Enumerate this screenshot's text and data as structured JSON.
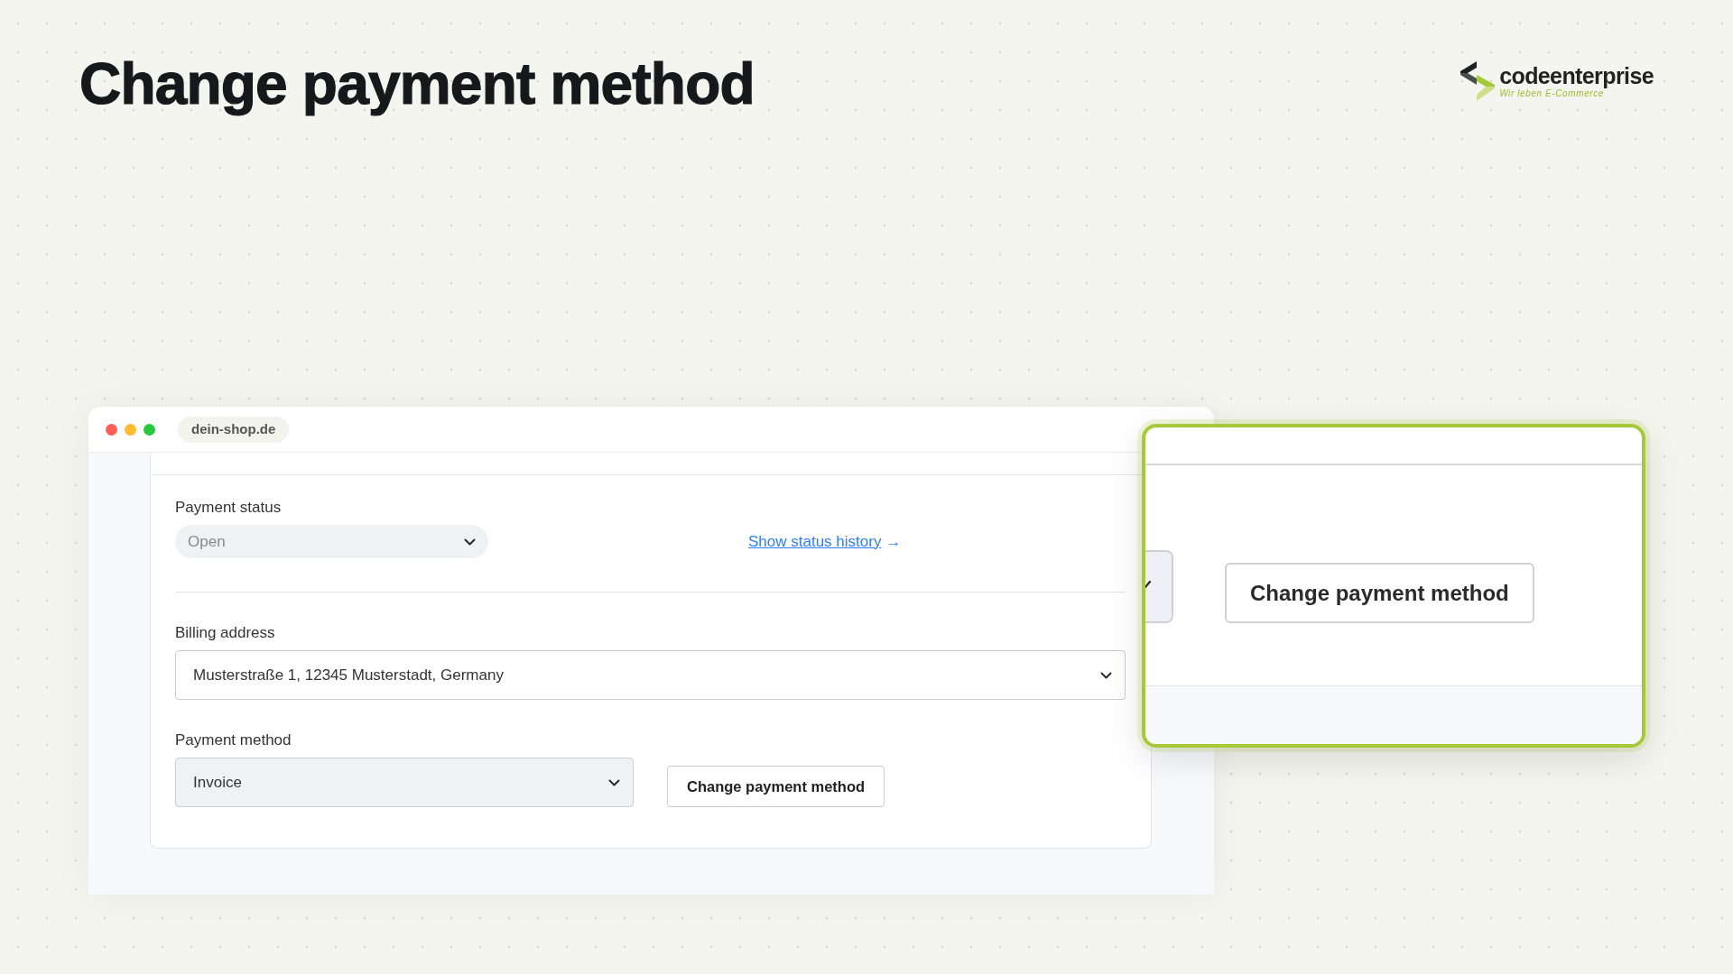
{
  "header": {
    "title": "Change payment method"
  },
  "logo": {
    "wordmark": "codeenterprise",
    "tagline": "Wir leben E-Commerce"
  },
  "browser": {
    "url": "dein-shop.de"
  },
  "form": {
    "payment_status": {
      "label": "Payment status",
      "select": {
        "value": "Open",
        "kind": "pill",
        "disabled": true
      }
    },
    "status_link": {
      "label": "Show status history",
      "arrow": "→"
    },
    "billing_address": {
      "label": "Billing address",
      "select": {
        "value": "Musterstraße 1, 12345 Musterstadt, Germany",
        "kind": "box",
        "disabled": false
      }
    },
    "payment_method": {
      "label": "Payment method",
      "select": {
        "value": "Invoice",
        "kind": "box",
        "disabled": true
      }
    },
    "change_button": {
      "label": "Change payment method"
    }
  },
  "zoom_callout": {
    "button": {
      "label": "Change payment method"
    }
  }
}
